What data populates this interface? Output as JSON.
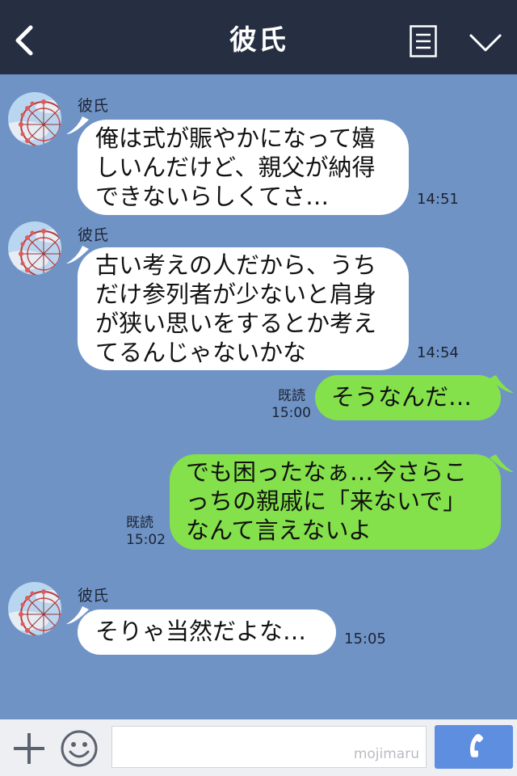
{
  "header": {
    "title": "彼氏"
  },
  "messages": [
    {
      "sender": "彼氏",
      "text": "俺は式が賑やかになって嬉\nしいんだけど、親父が納得\nできないらしくてさ…",
      "time": "14:51"
    },
    {
      "sender": "彼氏",
      "text": "古い考えの人だから、うち\nだけ参列者が少ないと肩身\nが狭い思いをするとか考え\nてるんじゃないかな",
      "time": "14:54"
    },
    {
      "sender": "me",
      "text": "そうなんだ…",
      "read": "既読",
      "time": "15:00"
    },
    {
      "sender": "me",
      "text": "でも困ったなぁ…今さらこ\nっちの親戚に「来ないで」\nなんて言えないよ",
      "read": "既読",
      "time": "15:02"
    },
    {
      "sender": "彼氏",
      "text": "そりゃ当然だよな…",
      "time": "15:05"
    }
  ],
  "footer": {
    "watermark": "mojimaru"
  },
  "colors": {
    "header": "#262f42",
    "background": "#7093c6",
    "incoming": "#ffffff",
    "outgoing": "#84e04b",
    "call_button": "#5e8ee0"
  },
  "icons": [
    "back-icon",
    "menu-icon",
    "chevron-down-icon",
    "plus-icon",
    "emoji-icon",
    "phone-icon"
  ]
}
